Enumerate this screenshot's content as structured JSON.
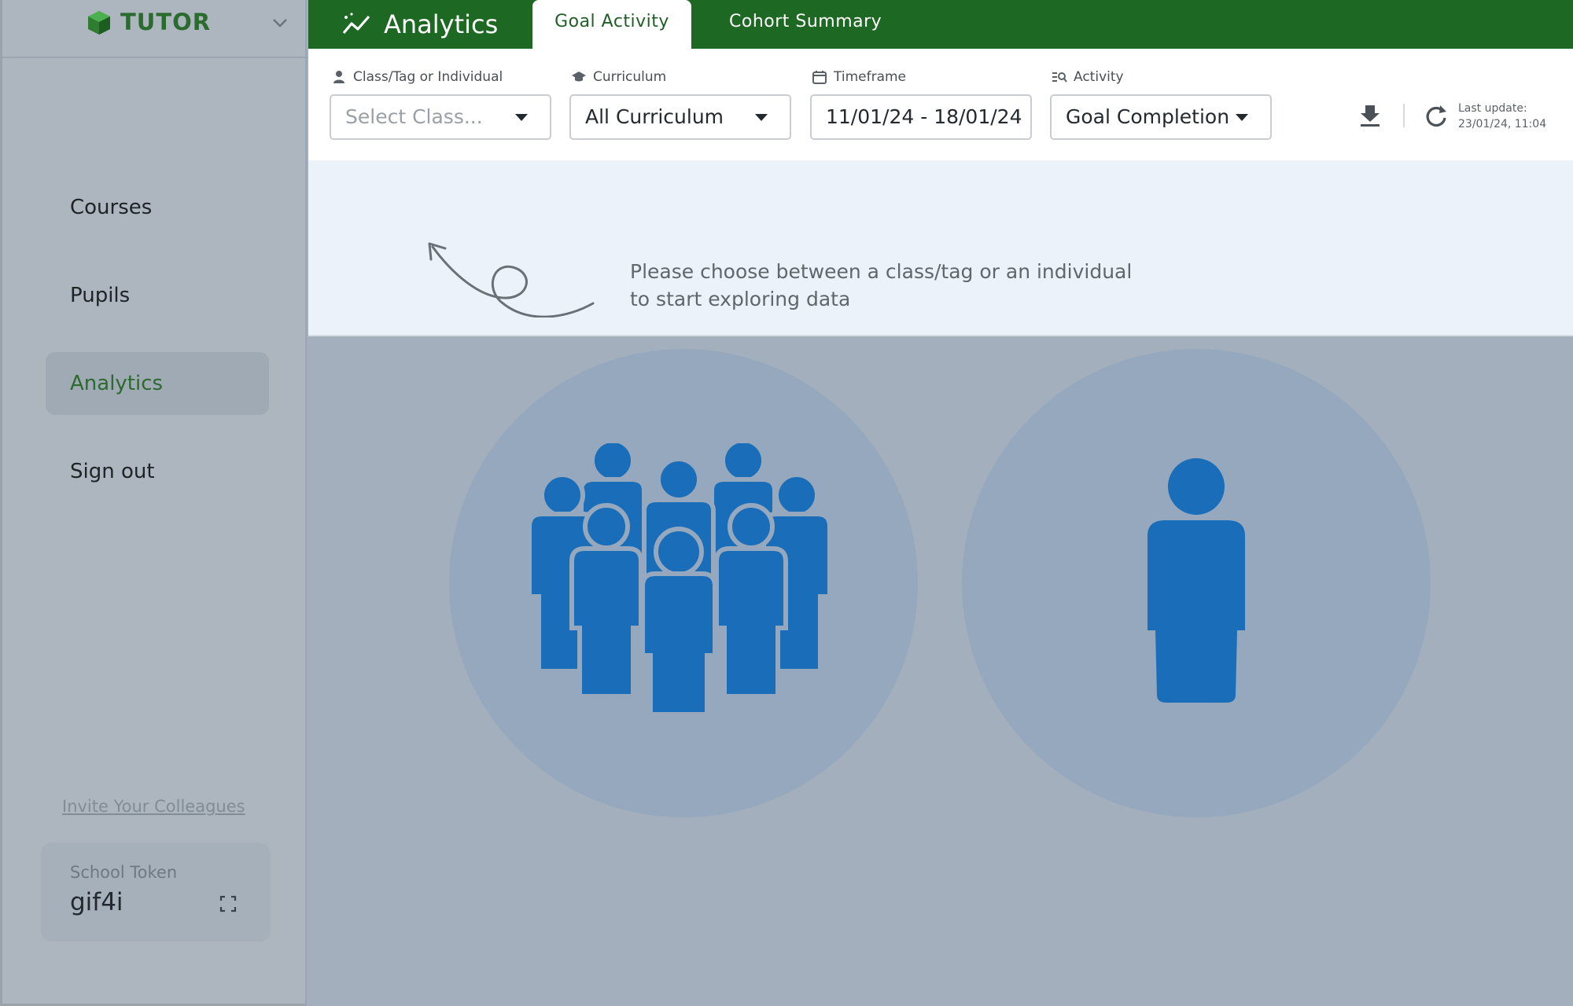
{
  "brand": {
    "name": "TUTOR"
  },
  "sidebar": {
    "items": [
      {
        "label": "Courses"
      },
      {
        "label": "Pupils"
      },
      {
        "label": "Analytics"
      },
      {
        "label": "Sign out"
      }
    ],
    "invite_link": "Invite Your Colleagues",
    "token": {
      "label": "School Token",
      "value": "gif4i"
    }
  },
  "header": {
    "title": "Analytics",
    "tabs": [
      {
        "label": "Goal Activity",
        "active": true
      },
      {
        "label": "Cohort Summary",
        "active": false
      }
    ]
  },
  "filters": {
    "class_tag": {
      "label": "Class/Tag or Individual",
      "placeholder": "Select Class..."
    },
    "curriculum": {
      "label": "Curriculum",
      "value": "All Curriculum"
    },
    "timeframe": {
      "label": "Timeframe",
      "value": "11/01/24 - 18/01/24"
    },
    "activity": {
      "label": "Activity",
      "value": "Goal Completion"
    },
    "last_update": {
      "label": "Last update:",
      "value": "23/01/24, 11:04"
    }
  },
  "hint": {
    "line1": "Please choose between a class/tag or an individual",
    "line2": "to start exploring data"
  },
  "choices": {
    "group_icon": "group-icon",
    "individual_icon": "person-icon"
  },
  "colors": {
    "brand_green": "#1d6822",
    "icon_blue": "#1a6db8",
    "circle_bg": "#95a8be",
    "overlay": "#a3afbc"
  }
}
